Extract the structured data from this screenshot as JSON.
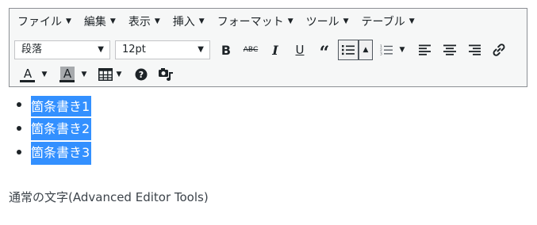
{
  "menubar": {
    "items": [
      {
        "label": "ファイル",
        "caret": "▼"
      },
      {
        "label": "編集",
        "caret": "▼"
      },
      {
        "label": "表示",
        "caret": "▼"
      },
      {
        "label": "挿入",
        "caret": "▼"
      },
      {
        "label": "フォーマット",
        "caret": "▼"
      },
      {
        "label": "ツール",
        "caret": "▼"
      },
      {
        "label": "テーブル",
        "caret": "▼"
      }
    ]
  },
  "toolbar": {
    "format_select": "段落",
    "font_size_select": "12pt",
    "bold_label": "B",
    "strike_label": "ABC",
    "italic_label": "I",
    "underline_label": "U",
    "blockquote_label": "“",
    "caret": "▼",
    "list_up_caret": "▲",
    "text_color_label": "A",
    "bg_color_label": "A",
    "help_label": "?"
  },
  "content": {
    "bullets": [
      "箇条書き1",
      "箇条書き2",
      "箇条書き3"
    ],
    "paragraph": "通常の文字(Advanced Editor Tools)"
  },
  "colors": {
    "selection": "#3390ff",
    "toolbar_bg": "#f6f7f7",
    "toolbar_border": "#8c8f94",
    "text": "#1d2327"
  }
}
